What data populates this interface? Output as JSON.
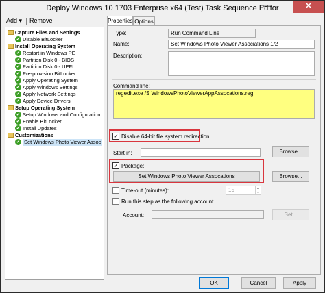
{
  "window": {
    "title": "Deploy Windows 10 1703 Enterprise x64 (Test) Task Sequence Editor",
    "minimize_glyph": "—",
    "maximize_glyph": "☐",
    "close_glyph": "✕"
  },
  "toolbar": {
    "add_label": "Add ▾",
    "remove_label": "Remove"
  },
  "tree": {
    "items": [
      {
        "label": "Capture Files and Settings",
        "kind": "group",
        "icon": "folder-icon"
      },
      {
        "label": "Disable BitLocker",
        "kind": "step",
        "icon": "check-icon"
      },
      {
        "label": "Install Operating System",
        "kind": "group",
        "icon": "folder-icon"
      },
      {
        "label": "Restart in Windows PE",
        "kind": "step",
        "icon": "check-icon"
      },
      {
        "label": "Partition Disk 0 - BIOS",
        "kind": "step",
        "icon": "check-icon"
      },
      {
        "label": "Partition Disk 0 - UEFI",
        "kind": "step",
        "icon": "check-icon"
      },
      {
        "label": "Pre-provision BitLocker",
        "kind": "step",
        "icon": "check-icon"
      },
      {
        "label": "Apply Operating System",
        "kind": "step",
        "icon": "check-icon"
      },
      {
        "label": "Apply Windows Settings",
        "kind": "step",
        "icon": "check-icon"
      },
      {
        "label": "Apply Network Settings",
        "kind": "step",
        "icon": "check-icon"
      },
      {
        "label": "Apply Device Drivers",
        "kind": "step",
        "icon": "check-icon"
      },
      {
        "label": "Setup Operating System",
        "kind": "group",
        "icon": "folder-icon"
      },
      {
        "label": "Setup Windows and Configuration",
        "kind": "step",
        "icon": "check-icon"
      },
      {
        "label": "Enable BitLocker",
        "kind": "step",
        "icon": "check-icon"
      },
      {
        "label": "Install Updates",
        "kind": "step",
        "icon": "check-icon"
      },
      {
        "label": "Customizations",
        "kind": "group",
        "icon": "folder-icon"
      },
      {
        "label": "Set Windows Photo Viewer Assoc",
        "kind": "step",
        "icon": "check-icon",
        "selected": true
      }
    ]
  },
  "tabs": [
    {
      "label": "Properties",
      "active": true
    },
    {
      "label": "Options",
      "active": false
    }
  ],
  "properties": {
    "type_label": "Type:",
    "type_value": "Run Command Line",
    "name_label": "Name:",
    "name_value": "Set Windows Photo Viewer Associations 1/2",
    "description_label": "Description:",
    "description_value": "",
    "command_line_label": "Command line:",
    "command_line_value": "regedit.exe /S WindowsPhotoViewerAppAssocations.reg",
    "disable_redirection_label": "Disable 64-bit file system redirection",
    "disable_redirection_checked": true,
    "start_in_label": "Start in:",
    "start_in_value": "",
    "start_in_browse": "Browse...",
    "package_label": "Package:",
    "package_checked": true,
    "package_value": "Set Windows Photo Viewer Assocations",
    "package_browse": "Browse...",
    "timeout_label": "Time-out (minutes):",
    "timeout_checked": false,
    "timeout_value": "15",
    "run_as_label": "Run this step as the following account",
    "run_as_checked": false,
    "account_label": "Account:",
    "account_value": "",
    "account_set": "Set...",
    "check_glyph": "✓"
  },
  "footer": {
    "ok": "OK",
    "cancel": "Cancel",
    "apply": "Apply"
  },
  "colors": {
    "highlight": "#d9363e",
    "command_bg": "#ffff80",
    "close_bg": "#c75050",
    "step_check": "#3a9d23"
  }
}
